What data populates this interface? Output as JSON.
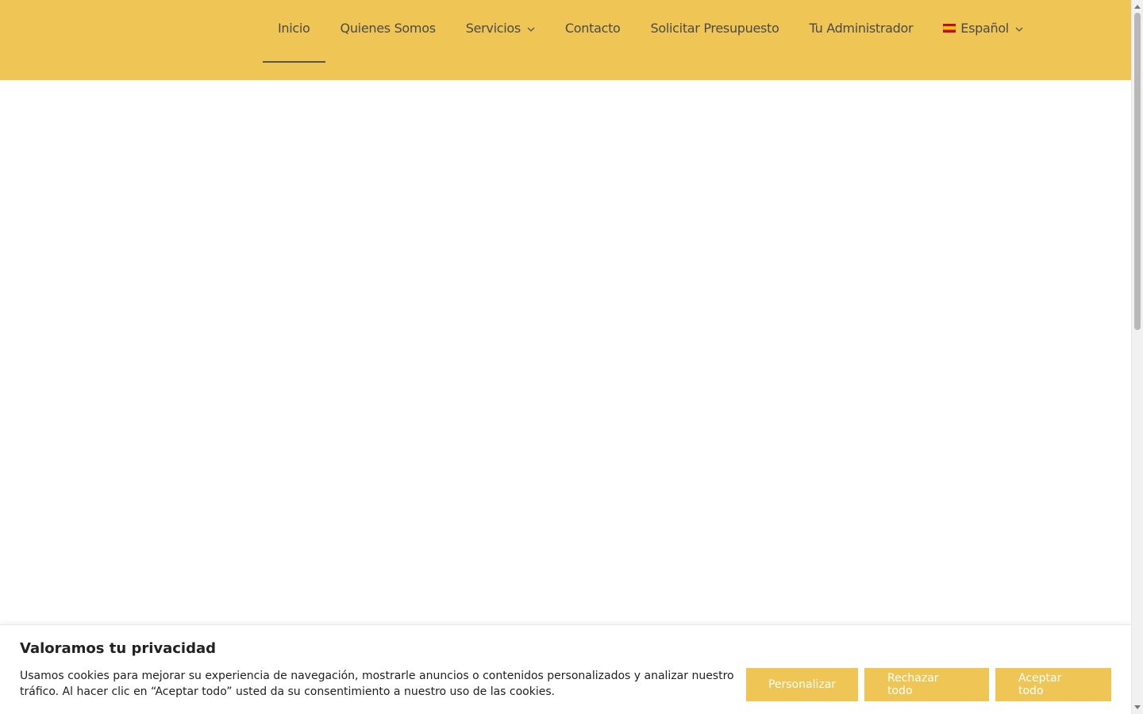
{
  "header": {
    "background_color": "#efc655",
    "nav": [
      {
        "label": "Inicio",
        "active": true,
        "has_dropdown": false
      },
      {
        "label": "Quienes Somos",
        "active": false,
        "has_dropdown": false
      },
      {
        "label": "Servicios",
        "active": false,
        "has_dropdown": true
      },
      {
        "label": "Contacto",
        "active": false,
        "has_dropdown": false
      },
      {
        "label": "Solicitar Presupuesto",
        "active": false,
        "has_dropdown": false
      },
      {
        "label": "Tu Administrador",
        "active": false,
        "has_dropdown": false
      }
    ],
    "language": {
      "label": "Español",
      "flag_icon": "spain-flag-icon"
    }
  },
  "cookie_banner": {
    "title": "Valoramos tu privacidad",
    "text": "Usamos cookies para mejorar su experiencia de navegación, mostrarle anuncios o contenidos personalizados y analizar nuestro tráfico. Al hacer clic en “Aceptar todo” usted da su consentimiento a nuestro uso de las cookies.",
    "buttons": {
      "customize": "Personalizar",
      "reject": "Rechazar todo",
      "accept": "Aceptar todo"
    },
    "button_color": "#efc655"
  }
}
